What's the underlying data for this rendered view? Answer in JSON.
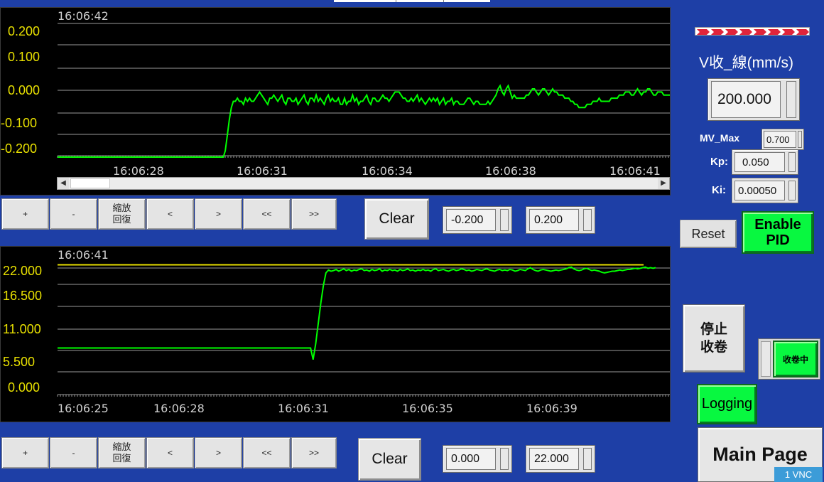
{
  "chart1": {
    "time_label": "16:06:42",
    "y_ticks": [
      "0.200",
      "0.100",
      "0.000",
      "-0.100",
      "-0.200"
    ],
    "x_ticks": [
      "16:06:28",
      "16:06:31",
      "16:06:34",
      "16:06:38",
      "16:06:41"
    ],
    "toolbar": {
      "plus": "+",
      "minus": "-",
      "zoom_reset": "縮放 回復",
      "prev": "<",
      "next": ">",
      "first": "<<",
      "last": ">>"
    },
    "clear_label": "Clear",
    "min_value": "-0.200",
    "max_value": "0.200"
  },
  "chart2": {
    "time_label": "16:06:41",
    "y_ticks": [
      "22.000",
      "16.500",
      "11.000",
      "5.500",
      "0.000"
    ],
    "x_ticks": [
      "16:06:25",
      "16:06:28",
      "16:06:31",
      "16:06:35",
      "16:06:39"
    ],
    "toolbar": {
      "plus": "+",
      "minus": "-",
      "zoom_reset": "縮放 回復",
      "prev": "<",
      "next": ">",
      "first": "<<",
      "last": ">>"
    },
    "clear_label": "Clear",
    "min_value": "0.000",
    "max_value": "22.000"
  },
  "right_panel": {
    "v_label": "V收_線(mm/s)",
    "v_value": "200.000",
    "mv_max_label": "MV_Max",
    "mv_max_value": "0.700",
    "kp_label": "Kp:",
    "kp_value": "0.050",
    "ki_label": "Ki:",
    "ki_value": "0.00050",
    "reset_label": "Reset",
    "enable_pid_label_line1": "Enable",
    "enable_pid_label_line2": "PID",
    "stop_label_line1": "停止",
    "stop_label_line2": "收卷",
    "winding_status": "收卷中",
    "logging_label": "Logging",
    "main_page_label": "Main Page",
    "vnc_label": "1 VNC"
  },
  "colors": {
    "background": "#1e3fa6",
    "trend": "#00ff00",
    "setpoint": "#e8e000",
    "tick_text": "#e8e000",
    "indicator_on": "#08f840"
  },
  "chart_data": [
    {
      "type": "line",
      "title": "",
      "y_ticks": [
        "0.200",
        "0.100",
        "0.000",
        "-0.100",
        "-0.200"
      ],
      "ylim": [
        -0.22,
        0.22
      ],
      "x_ticks": [
        "16:06:28",
        "16:06:31",
        "16:06:34",
        "16:06:38",
        "16:06:41"
      ],
      "series": [
        {
          "values": [
            -0.22,
            -0.22,
            -0.22,
            -0.22,
            -0.22,
            -0.22,
            -0.22,
            -0.22,
            -0.22,
            -0.22,
            -0.22,
            -0.22,
            -0.22,
            -0.22,
            -0.22,
            -0.22,
            -0.22,
            -0.22,
            -0.22,
            -0.22,
            -0.22,
            -0.22,
            -0.22,
            -0.22,
            -0.22,
            -0.22,
            -0.22,
            -0.22,
            -0.22,
            -0.22,
            -0.22,
            -0.22,
            -0.22,
            -0.22,
            -0.22,
            -0.22,
            -0.22,
            -0.22,
            -0.22,
            -0.22,
            -0.22,
            -0.22,
            -0.22,
            -0.22,
            -0.22,
            -0.22,
            -0.22,
            -0.22,
            -0.22,
            -0.22,
            -0.22,
            -0.22,
            -0.22,
            -0.22,
            -0.22,
            -0.22,
            -0.22,
            -0.22,
            -0.22,
            -0.22,
            -0.22,
            -0.22,
            -0.22,
            -0.22,
            -0.22,
            -0.22,
            -0.22,
            -0.22,
            -0.22,
            -0.22,
            -0.22,
            -0.22,
            -0.22,
            -0.22,
            -0.22,
            -0.22,
            -0.22,
            -0.22,
            -0.22,
            -0.22,
            -0.22,
            -0.22,
            -0.22,
            -0.2,
            -0.15,
            -0.1,
            -0.06,
            -0.04,
            -0.04,
            -0.03,
            -0.04,
            -0.04,
            -0.05,
            -0.03,
            -0.04,
            -0.03,
            -0.04,
            -0.04,
            -0.03,
            -0.02,
            -0.01,
            -0.02,
            -0.03,
            -0.04,
            -0.05,
            -0.03,
            -0.03,
            -0.02,
            -0.03,
            -0.04,
            -0.03,
            -0.02,
            -0.04,
            -0.05,
            -0.03,
            -0.03,
            -0.04,
            -0.04,
            -0.03,
            -0.05,
            -0.04,
            -0.03,
            -0.02,
            -0.04,
            -0.05,
            -0.03,
            -0.03,
            -0.04,
            -0.02,
            -0.04,
            -0.03,
            -0.04,
            -0.05,
            -0.03,
            -0.02,
            -0.04,
            -0.03,
            -0.04,
            -0.04,
            -0.03,
            -0.05,
            -0.05,
            -0.03,
            -0.05,
            -0.04,
            -0.04,
            -0.02,
            -0.04,
            -0.03,
            -0.05,
            -0.04,
            -0.04,
            -0.03,
            -0.02,
            -0.04,
            -0.05,
            -0.03,
            -0.03,
            -0.04,
            -0.04,
            -0.03,
            -0.02,
            -0.03,
            -0.03,
            -0.04,
            -0.03,
            -0.02,
            -0.01,
            -0.01,
            -0.01,
            -0.02,
            -0.03,
            -0.03,
            -0.04,
            -0.04,
            -0.03,
            -0.04,
            -0.03,
            -0.02,
            -0.04,
            -0.03,
            -0.04,
            -0.05,
            -0.04,
            -0.03,
            -0.04,
            -0.03,
            -0.04,
            -0.03,
            -0.05,
            -0.04,
            -0.03,
            -0.05,
            -0.04,
            -0.04,
            -0.03,
            -0.05,
            -0.04,
            -0.04,
            -0.05,
            -0.05,
            -0.05,
            -0.04,
            -0.03,
            -0.03,
            -0.04,
            -0.05,
            -0.04,
            -0.04,
            -0.05,
            -0.05,
            -0.05,
            -0.05,
            -0.04,
            -0.05,
            -0.04,
            -0.03,
            -0.02,
            0.0,
            0.01,
            -0.01,
            -0.02,
            0.0,
            0.01,
            -0.01,
            -0.03,
            -0.02,
            -0.03,
            -0.03,
            -0.03,
            -0.03,
            -0.03,
            -0.02,
            -0.02,
            -0.01,
            0.0,
            0.0,
            -0.01,
            -0.02,
            -0.01,
            0.0,
            0.0,
            -0.01,
            -0.02,
            -0.01,
            0.0,
            -0.01,
            -0.01,
            -0.02,
            -0.02,
            -0.02,
            -0.03,
            -0.03,
            -0.03,
            -0.04,
            -0.04,
            -0.05,
            -0.05,
            -0.06,
            -0.06,
            -0.06,
            -0.06,
            -0.05,
            -0.05,
            -0.05,
            -0.04,
            -0.04,
            -0.04,
            -0.03,
            -0.04,
            -0.04,
            -0.04,
            -0.04,
            -0.04,
            -0.03,
            -0.03,
            -0.03,
            -0.03,
            -0.02,
            -0.02,
            -0.02,
            -0.01,
            -0.01,
            -0.01,
            -0.02,
            -0.02,
            -0.01,
            0.0,
            -0.01,
            -0.02,
            -0.01,
            -0.01,
            0.0,
            0.0,
            -0.01,
            -0.02,
            -0.02,
            -0.01,
            -0.01,
            -0.01,
            -0.02,
            -0.02,
            -0.02,
            -0.02
          ]
        }
      ]
    },
    {
      "type": "line",
      "title": "",
      "y_ticks": [
        "22.000",
        "16.500",
        "11.000",
        "5.500",
        "0.000"
      ],
      "ylim": [
        0,
        22
      ],
      "x_ticks": [
        "16:06:25",
        "16:06:28",
        "16:06:31",
        "16:06:35",
        "16:06:39"
      ],
      "series": [
        {
          "values": [
            20.6,
            20.6
          ]
        },
        {
          "values": [
            6.3,
            6.3,
            6.3,
            6.3,
            6.3,
            6.3,
            6.3,
            6.3,
            6.3,
            6.3,
            6.3,
            6.3,
            6.3,
            6.3,
            6.3,
            6.3,
            6.3,
            6.3,
            6.3,
            6.3,
            6.3,
            6.3,
            6.3,
            6.3,
            6.3,
            6.3,
            6.3,
            6.3,
            6.3,
            6.3,
            6.3,
            6.3,
            6.3,
            6.3,
            6.3,
            6.3,
            6.3,
            6.3,
            6.3,
            6.3,
            6.3,
            6.3,
            6.3,
            6.3,
            6.3,
            6.3,
            6.3,
            6.3,
            6.3,
            6.3,
            6.3,
            6.3,
            6.3,
            6.3,
            6.3,
            6.3,
            6.3,
            6.3,
            6.3,
            6.3,
            6.3,
            6.3,
            6.3,
            6.3,
            6.3,
            6.3,
            6.3,
            6.3,
            6.3,
            6.3,
            6.3,
            6.3,
            6.3,
            6.3,
            6.3,
            6.3,
            6.3,
            6.3,
            6.3,
            6.3,
            6.3,
            6.3,
            6.3,
            6.3,
            6.3,
            6.3,
            6.3,
            6.3,
            6.3,
            6.3,
            6.3,
            6.3,
            6.3,
            6.3,
            6.3,
            6.3,
            6.3,
            6.3,
            6.3,
            6.3,
            4.3,
            7.0,
            10.5,
            14.0,
            17.0,
            19.2,
            19.7,
            19.5,
            19.6,
            19.8,
            19.5,
            19.7,
            19.9,
            19.6,
            19.8,
            19.5,
            19.7,
            19.6,
            19.8,
            19.9,
            19.6,
            19.7,
            19.5,
            19.8,
            19.6,
            19.7,
            19.9,
            19.5,
            19.7,
            19.6,
            19.8,
            19.6,
            19.7,
            19.5,
            19.8,
            19.6,
            19.7,
            19.9,
            19.6,
            19.7,
            19.5,
            19.7,
            19.6,
            19.8,
            19.6,
            19.7,
            19.5,
            19.8,
            19.9,
            19.6,
            19.7,
            19.8,
            19.6,
            19.5,
            19.7,
            19.8,
            19.6,
            19.7,
            19.9,
            19.8,
            19.6,
            19.7,
            19.5,
            19.6,
            19.8,
            19.7,
            19.6,
            19.8,
            19.9,
            19.7,
            19.6,
            19.5,
            19.7,
            19.8,
            19.6,
            19.7,
            19.6,
            19.8,
            19.7,
            19.5,
            19.6,
            19.8,
            19.7,
            19.6,
            19.9,
            20.1,
            19.8,
            19.6,
            19.5,
            19.7,
            19.8,
            19.7,
            19.6,
            19.5,
            19.6,
            19.7,
            19.6,
            19.7,
            19.8,
            19.9,
            20.1,
            20.2,
            19.9,
            19.7,
            19.6,
            19.7,
            19.9,
            20.0,
            19.8,
            19.6,
            19.7,
            19.6,
            19.5,
            19.3,
            19.2,
            19.3,
            19.4,
            19.5,
            19.5,
            19.6,
            19.7,
            19.6,
            19.7,
            19.8,
            19.8,
            19.9,
            20.0,
            19.9,
            20.0,
            20.1,
            20.2,
            20.0,
            20.1,
            20.0,
            20.1
          ]
        }
      ]
    }
  ]
}
